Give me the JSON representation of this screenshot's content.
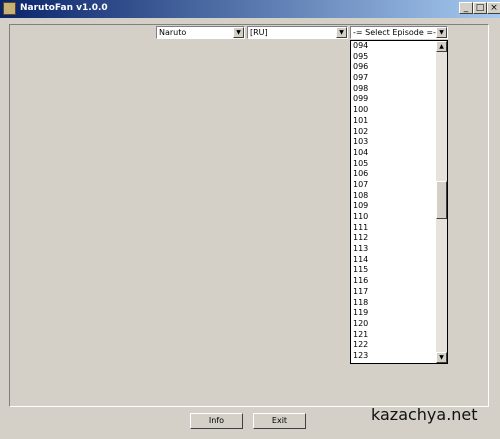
{
  "window": {
    "title": "NarutoFan v1.0.0"
  },
  "controls": {
    "anime_combo": "Naruto",
    "lang_combo": "[RU]",
    "episode_combo": "-= Select Episode =-"
  },
  "episodes": [
    "094",
    "095",
    "096",
    "097",
    "098",
    "099",
    "100",
    "101",
    "102",
    "103",
    "104",
    "105",
    "106",
    "107",
    "108",
    "109",
    "110",
    "111",
    "112",
    "113",
    "114",
    "115",
    "116",
    "117",
    "118",
    "119",
    "120",
    "121",
    "122",
    "123"
  ],
  "buttons": {
    "info": "Info",
    "exit": "Exit"
  },
  "watermark": "kazachya.net",
  "icons": {
    "app": "app-icon",
    "dropdown": "chevron-down-icon"
  }
}
